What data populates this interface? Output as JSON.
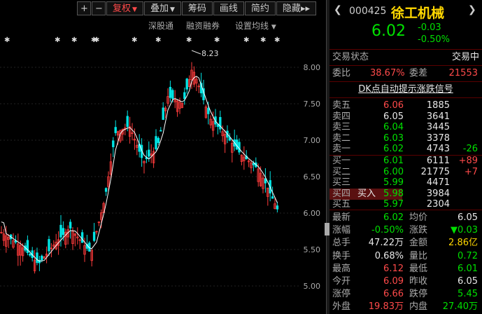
{
  "toolbar": {
    "plus": "+",
    "minus": "−",
    "adjust": "复权",
    "overlay": "叠加",
    "chips": "筹码",
    "draw": "画线",
    "brief": "简约",
    "hide": "隐藏",
    "more": "▸▸"
  },
  "subtool": {
    "sgt": "深股通",
    "margin": "融资融券",
    "ma_settings": "设置均线"
  },
  "chart": {
    "max_label": "8.23",
    "axis": [
      "8.00",
      "7.50",
      "7.00",
      "6.50",
      "6.00",
      "5.50",
      "5.00"
    ]
  },
  "quote": {
    "code": "000425",
    "name": "徐工机械",
    "price": "6.02",
    "change": "-0.03",
    "change_pct": "-0.50%",
    "status_label": "交易状态",
    "status_value": "交易中",
    "weibi_label": "委比",
    "weibi_value": "38.67%",
    "weicha_label": "委差",
    "weicha_value": "21553",
    "dk_link": "DK点自动提示涨跌信号",
    "asks": [
      {
        "label": "卖五",
        "price": "6.06",
        "vol": "1885",
        "chg": ""
      },
      {
        "label": "卖四",
        "price": "6.05",
        "vol": "3641",
        "chg": ""
      },
      {
        "label": "卖三",
        "price": "6.04",
        "vol": "3445",
        "chg": ""
      },
      {
        "label": "卖二",
        "price": "6.03",
        "vol": "3378",
        "chg": ""
      },
      {
        "label": "卖一",
        "price": "6.02",
        "vol": "4743",
        "chg": "-26"
      }
    ],
    "bids": [
      {
        "label": "买一",
        "price": "6.01",
        "vol": "6111",
        "chg": "+89"
      },
      {
        "label": "买二",
        "price": "6.00",
        "vol": "21775",
        "chg": "+7"
      },
      {
        "label": "买三",
        "price": "5.99",
        "vol": "4471",
        "chg": ""
      },
      {
        "label": "买四",
        "price": "5.98",
        "vol": "3984",
        "chg": ""
      },
      {
        "label": "买五",
        "price": "5.97",
        "vol": "2304",
        "chg": ""
      }
    ],
    "buy_tag": "买入",
    "stats": [
      {
        "l1": "最新",
        "v1": "6.02",
        "l2": "均价",
        "v2": "6.05"
      },
      {
        "l1": "涨幅",
        "v1": "-0.50%",
        "l2": "涨跌",
        "v2": "▼0.03"
      },
      {
        "l1": "总手",
        "v1": "47.22万",
        "l2": "金额",
        "v2": "2.86亿"
      },
      {
        "l1": "换手",
        "v1": "0.68%",
        "l2": "量比",
        "v2": "0.72"
      },
      {
        "l1": "最高",
        "v1": "6.12",
        "l2": "最低",
        "v2": "6.01"
      },
      {
        "l1": "今开",
        "v1": "6.09",
        "l2": "昨收",
        "v2": "6.05"
      },
      {
        "l1": "涨停",
        "v1": "6.66",
        "l2": "跌停",
        "v2": "5.45"
      },
      {
        "l1": "外盘",
        "v1": "19.83万",
        "l2": "内盘",
        "v2": "27.40万"
      }
    ]
  }
}
